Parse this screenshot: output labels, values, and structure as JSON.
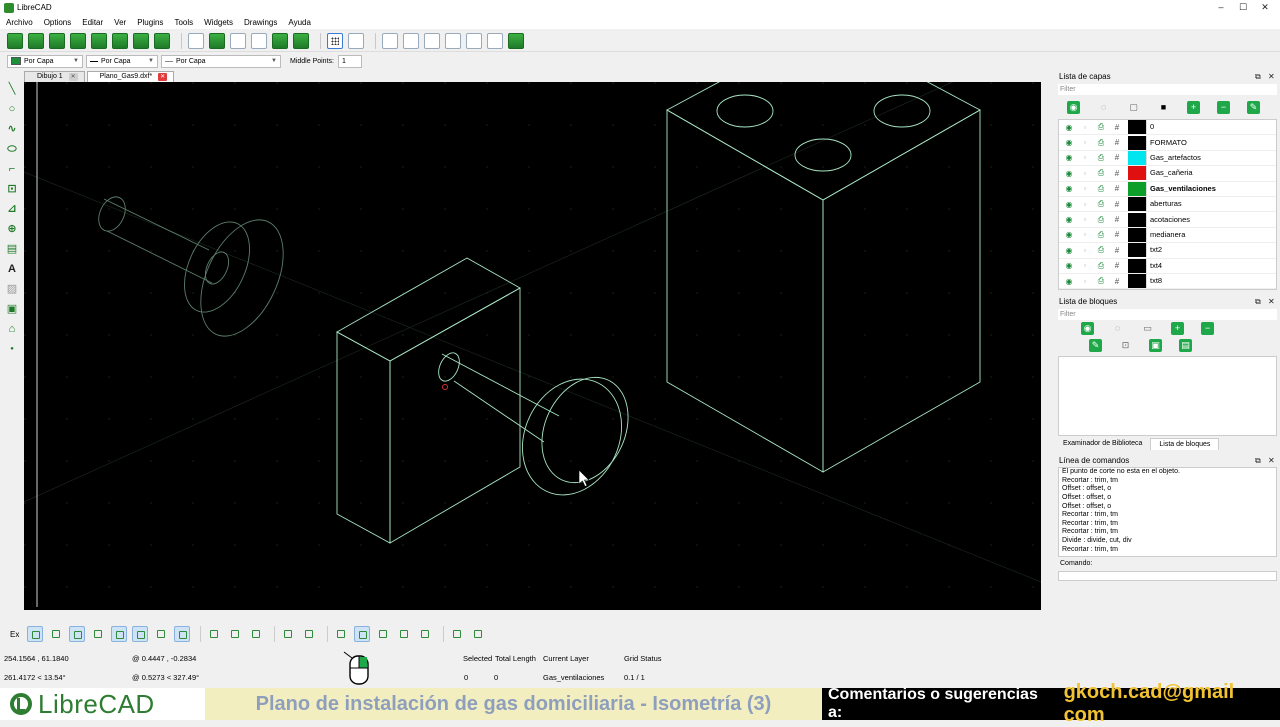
{
  "app": {
    "title": "LibreCAD"
  },
  "window_controls": {
    "minimize": "–",
    "maximize": "☐",
    "close": "✕"
  },
  "menu": [
    "Archivo",
    "Options",
    "Editar",
    "Ver",
    "Plugins",
    "Tools",
    "Widgets",
    "Drawings",
    "Ayuda"
  ],
  "properties": {
    "color": "Por Capa",
    "line_width": "Por Capa",
    "line_type": "Por Capa",
    "middle_points_label": "Middle Points:",
    "middle_points_value": "1"
  },
  "tabs": [
    {
      "label": "Dibujo 1",
      "active": false
    },
    {
      "label": "Plano_Gas9.dxf*",
      "active": true
    }
  ],
  "layers_panel": {
    "title": "Lista de capas",
    "filter_placeholder": "Filter",
    "layers": [
      {
        "name": "0",
        "color": "#000000",
        "bold": false
      },
      {
        "name": "FORMATO",
        "color": "#000000",
        "bold": false
      },
      {
        "name": "Gas_artefactos",
        "color": "#00e5ee",
        "bold": false
      },
      {
        "name": "Gas_cañeria",
        "color": "#e01010",
        "bold": false
      },
      {
        "name": "Gas_ventilaciones",
        "color": "#0d9e2a",
        "bold": true
      },
      {
        "name": "aberturas",
        "color": "#000000",
        "bold": false
      },
      {
        "name": "acotaciones",
        "color": "#000000",
        "bold": false
      },
      {
        "name": "medianera",
        "color": "#000000",
        "bold": false
      },
      {
        "name": "txt2",
        "color": "#000000",
        "bold": false
      },
      {
        "name": "txt4",
        "color": "#000000",
        "bold": false
      },
      {
        "name": "txt8",
        "color": "#000000",
        "bold": false
      }
    ]
  },
  "blocks_panel": {
    "title": "Lista de bloques",
    "filter_placeholder": "Filter",
    "bottom_tabs": [
      "Examinador de Biblioteca",
      "Lista de bloques"
    ]
  },
  "command_panel": {
    "title": "Línea de comandos",
    "history": [
      "El punto de corte no esta en el objeto.",
      "Recortar : trim, tm",
      "Offset : offset, o",
      "Offset : offset, o",
      "Offset : offset, o",
      "Recortar : trim, tm",
      "Recortar : trim, tm",
      "Recortar : trim, tm",
      "Divide : divide, cut, div",
      "Recortar : trim, tm"
    ],
    "input_label": "Comando:"
  },
  "snap_label": "Ex",
  "status": {
    "abs_coords": "254.1564 , 61.1840",
    "abs_polar": "261.4172 < 13.54°",
    "rel_coords": "@  0.4447 , -0.2834",
    "rel_polar": "@  0.5273 < 327.49°",
    "selected_label": "Selected",
    "selected_value": "0",
    "total_length_label": "Total Length",
    "total_length_value": "0",
    "current_layer_label": "Current Layer",
    "current_layer_value": "Gas_ventilaciones",
    "grid_status_label": "Grid Status",
    "grid_status_value": "0.1 / 1"
  },
  "banner": {
    "logo": "LibreCAD",
    "title": "Plano de instalación de gas domiciliaria - Isometría (3)",
    "comments": "Comentarios o sugerencias a:",
    "email": "gkoch.cad@gmail com"
  },
  "colors": {
    "accent": "#1fa84a",
    "drawing_line": "#b8f0d0",
    "canvas_bg": "#000000"
  }
}
